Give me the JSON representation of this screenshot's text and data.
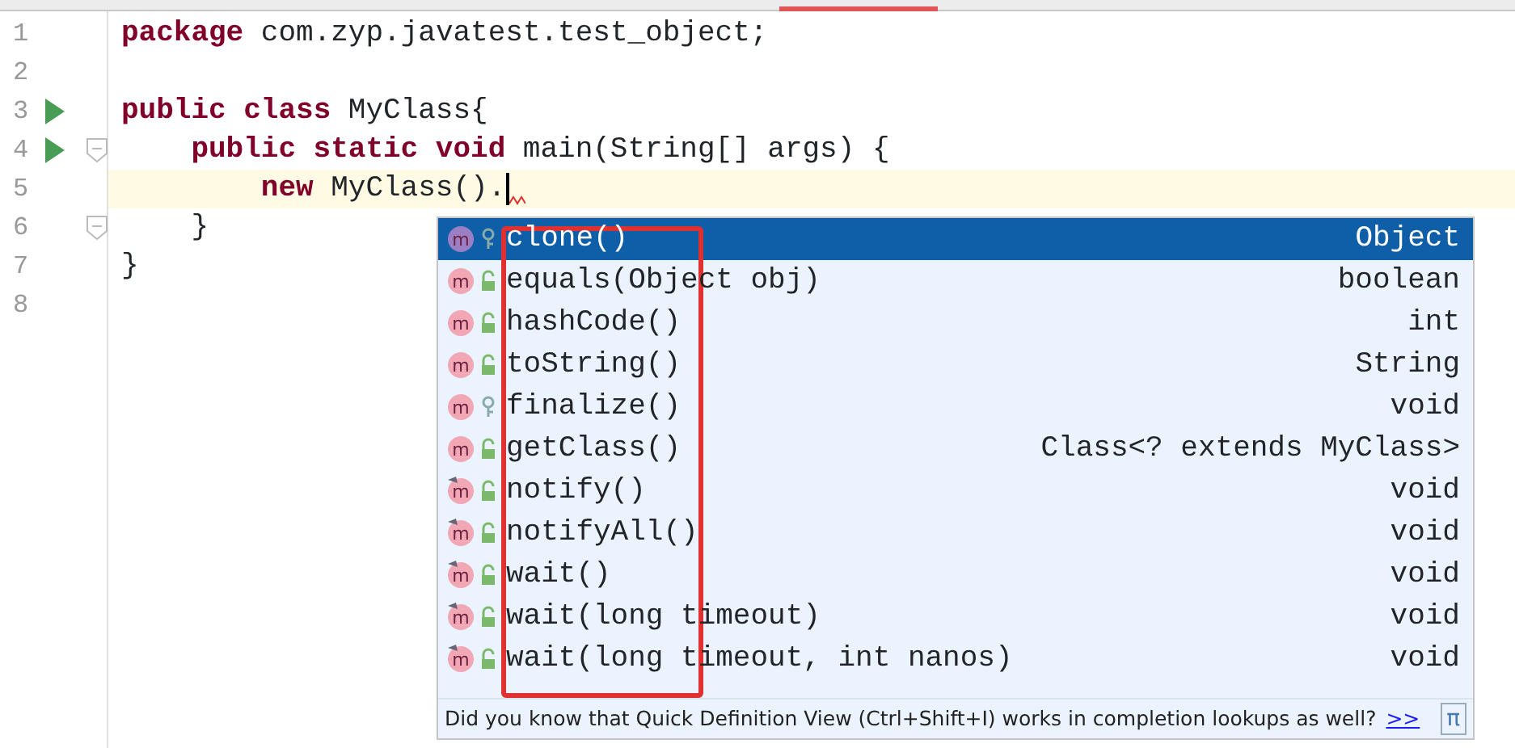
{
  "editor": {
    "lines": [
      {
        "number": "1",
        "segments": [
          {
            "kind": "keyword",
            "text": "package"
          },
          {
            "kind": "plain",
            "text": " com.zyp.javatest.test_object;"
          }
        ]
      },
      {
        "number": "2"
      },
      {
        "number": "3",
        "run": true,
        "segments": [
          {
            "kind": "keyword",
            "text": "public class"
          },
          {
            "kind": "plain",
            "text": " MyClass{"
          }
        ],
        "children": [
          {
            "number": "4",
            "run": true,
            "fold": true,
            "segments": [
              {
                "kind": "keyword",
                "text": "public static void"
              },
              {
                "kind": "plain",
                "text": " main(String[] args) {"
              }
            ],
            "children": [
              {
                "number": "5",
                "current": true,
                "caret": true,
                "segments": [
                  {
                    "kind": "keyword",
                    "text": "new"
                  },
                  {
                    "kind": "plain",
                    "text": " MyClass()."
                  }
                ]
              }
            ]
          },
          {
            "number": "6",
            "fold": true,
            "segments": [
              {
                "kind": "plain",
                "text": "}"
              }
            ]
          }
        ]
      },
      {
        "number": "7",
        "segments": [
          {
            "kind": "plain",
            "text": "}"
          }
        ]
      },
      {
        "number": "8"
      }
    ]
  },
  "completion": {
    "items": [
      {
        "badge": "m",
        "name": "clone()",
        "type": "Object",
        "protected": true,
        "final": false,
        "selected": true
      },
      {
        "badge": "m",
        "name": "equals(Object obj)",
        "type": "boolean",
        "protected": false,
        "final": false,
        "selected": false
      },
      {
        "badge": "m",
        "name": "hashCode()",
        "type": "int",
        "protected": false,
        "final": false,
        "selected": false
      },
      {
        "badge": "m",
        "name": "toString()",
        "type": "String",
        "protected": false,
        "final": false,
        "selected": false
      },
      {
        "badge": "m",
        "name": "finalize()",
        "type": "void",
        "protected": true,
        "final": false,
        "selected": false
      },
      {
        "badge": "m",
        "name": "getClass()",
        "type": "Class<? extends MyClass>",
        "protected": false,
        "final": false,
        "selected": false
      },
      {
        "badge": "m",
        "name": "notify()",
        "type": "void",
        "protected": false,
        "final": true,
        "selected": false
      },
      {
        "badge": "m",
        "name": "notifyAll()",
        "type": "void",
        "protected": false,
        "final": true,
        "selected": false
      },
      {
        "badge": "m",
        "name": "wait()",
        "type": "void",
        "protected": false,
        "final": true,
        "selected": false
      },
      {
        "badge": "m",
        "name": "wait(long timeout)",
        "type": "void",
        "protected": false,
        "final": true,
        "selected": false
      },
      {
        "badge": "m",
        "name": "wait(long timeout, int nanos)",
        "type": "void",
        "protected": false,
        "final": true,
        "selected": false
      }
    ],
    "tip": "Did you know that Quick Definition View (Ctrl+Shift+I) works in completion lookups as well?",
    "tip_link": ">>",
    "pi": "π"
  }
}
